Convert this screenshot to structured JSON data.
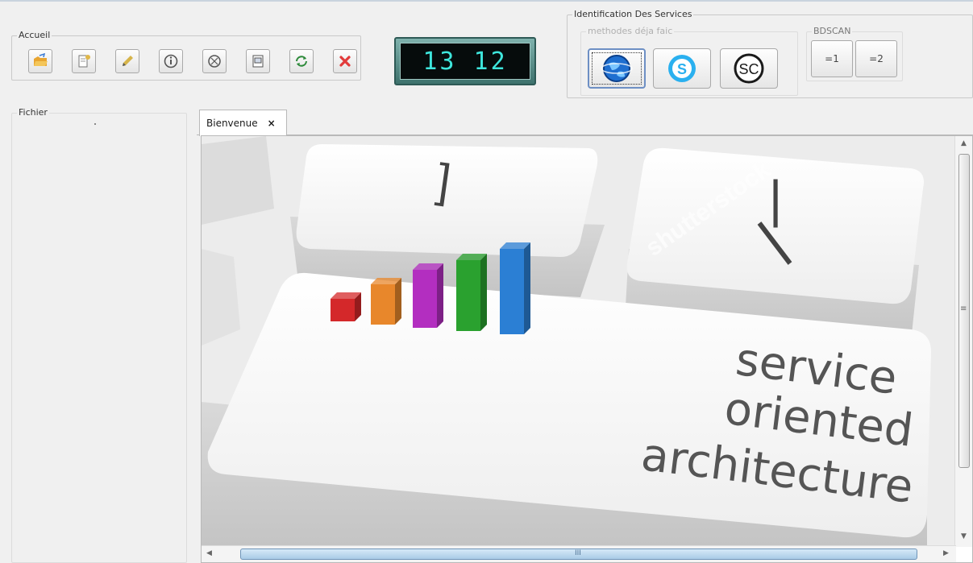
{
  "groups": {
    "accueil": "Accueil",
    "identification": "Identification Des Services",
    "methodes": "methodes déja faic",
    "bdscan": "BDSCAN",
    "fichier": "Fichier"
  },
  "toolbar": [
    {
      "name": "open-folder-icon",
      "color": "#e8a531"
    },
    {
      "name": "document-badge-icon",
      "color": "#e0b74a"
    },
    {
      "name": "pencil-icon",
      "color": "#d6b44a"
    },
    {
      "name": "info-icon",
      "color": "#555555"
    },
    {
      "name": "stop-icon",
      "color": "#555555"
    },
    {
      "name": "print-preview-icon",
      "color": "#555555"
    },
    {
      "name": "refresh-icon",
      "color": "#2d8a3a"
    },
    {
      "name": "close-red-icon",
      "color": "#e23a3a"
    }
  ],
  "clock": "13 12",
  "services": [
    {
      "name": "globe-icon",
      "label": ""
    },
    {
      "name": "skype-icon",
      "label": ""
    },
    {
      "name": "sc-icon",
      "label": "SC"
    }
  ],
  "bdscan_buttons": [
    "=1",
    "=2"
  ],
  "tabs": [
    {
      "label": "Bienvenue",
      "close": "×"
    }
  ],
  "banner": {
    "line1": "service",
    "line2": "oriented",
    "line3": "architecture",
    "key1": "]",
    "key2": "|",
    "watermark": "shutterstock",
    "bar_colors": [
      "#d4282a",
      "#e8872b",
      "#b32ec0",
      "#2aa12f",
      "#2b7fd4"
    ]
  },
  "scroll": {
    "hgrip": "III",
    "vgrip": "≡"
  }
}
